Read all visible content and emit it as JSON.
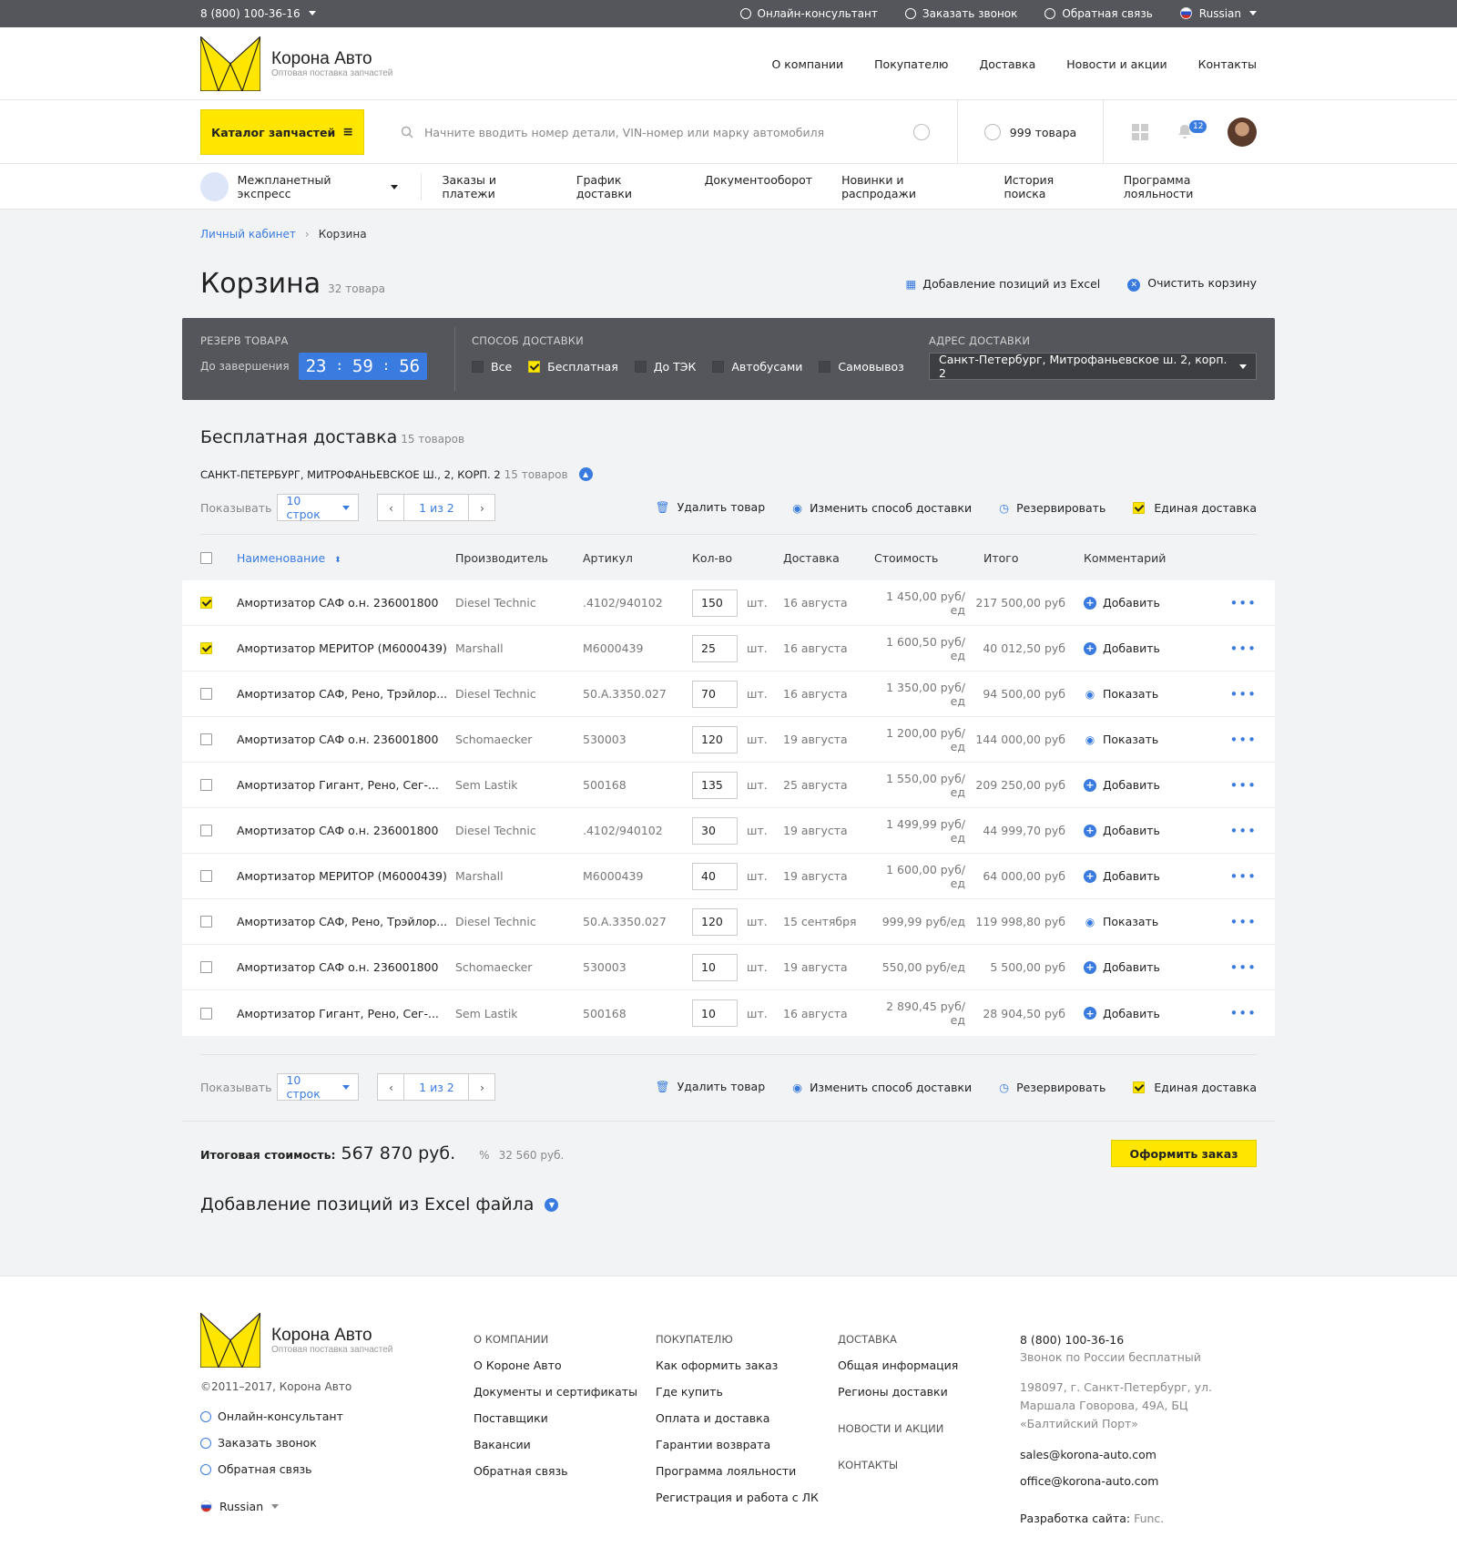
{
  "topbar": {
    "phone": "8 (800) 100-36-16",
    "links": [
      "Онлайн-консультант",
      "Заказать звонок",
      "Обратная связь"
    ],
    "language": "Russian"
  },
  "header": {
    "logo_name": "Корона Авто",
    "logo_sub": "Оптовая поставка запчастей",
    "nav": [
      "О компании",
      "Покупателю",
      "Доставка",
      "Новости и акции",
      "Контакты"
    ]
  },
  "search": {
    "catalog_label": "Каталог запчастей",
    "placeholder": "Начните вводить номер детали, VIN-номер или марку автомобиля",
    "cart_count": "999 товара",
    "notifications": "12"
  },
  "subnav": {
    "account": "Межпланетный экспресс",
    "links": [
      "Заказы и платежи",
      "График доставки",
      "Документооборот",
      "Новинки и распродажи",
      "История поиска",
      "Программа лояльности"
    ]
  },
  "breadcrumb": {
    "parent": "Личный кабинет",
    "current": "Корзина"
  },
  "page": {
    "title": "Корзина",
    "count": "32 товара",
    "excel_action": "Добавление позиций из Excel",
    "clear_action": "Очистить корзину"
  },
  "panel": {
    "reserve_label": "Резерв товара",
    "until_label": "До завершения",
    "timer": [
      "23",
      "59",
      "56"
    ],
    "delivery_label": "Способ доставки",
    "options": [
      {
        "label": "Все",
        "checked": false
      },
      {
        "label": "Бесплатная",
        "checked": true
      },
      {
        "label": "До ТЭК",
        "checked": false
      },
      {
        "label": "Автобусами",
        "checked": false
      },
      {
        "label": "Самовывоз",
        "checked": false
      }
    ],
    "address_label": "Адрес доставки",
    "address": "Санкт-Петербург, Митрофаньевское ш. 2, корп. 2"
  },
  "section": {
    "title": "Бесплатная доставка",
    "count": "15 товаров",
    "address": "САНКТ-ПЕТЕРБУРГ, МИТРОФАНЬЕВСКОЕ Ш., 2, КОРП. 2",
    "address_count": "15 товаров"
  },
  "tools": {
    "show_label": "Показывать",
    "rows": "10 строк",
    "page": "1 из 2",
    "delete": "Удалить товар",
    "change": "Изменить способ доставки",
    "reserve": "Резервировать",
    "single": "Единая доставка"
  },
  "table": {
    "headers": [
      "Наименование",
      "Производитель",
      "Артикул",
      "Кол-во",
      "Доставка",
      "Стоимость",
      "Итого",
      "Комментарий"
    ],
    "unit": "шт.",
    "rows": [
      {
        "checked": true,
        "name": "Амортизатор САФ о.н. 236001800",
        "maker": "Diesel Technic",
        "sku": ".4102/940102",
        "qty": "150",
        "date": "16 августа",
        "price": "1 450,00 руб/ед",
        "total": "217 500,00 руб",
        "comment": "Добавить",
        "ctype": "add"
      },
      {
        "checked": true,
        "name": "Амортизатор МЕРИТОР (M6000439)",
        "maker": "Marshall",
        "sku": "M6000439",
        "qty": "25",
        "date": "16 августа",
        "price": "1 600,50 руб/ед",
        "total": "40 012,50 руб",
        "comment": "Добавить",
        "ctype": "add"
      },
      {
        "checked": false,
        "name": "Амортизатор САФ, Рено, Трэйлор...",
        "maker": "Diesel Technic",
        "sku": "50.A.3350.027",
        "qty": "70",
        "date": "16 августа",
        "price": "1 350,00 руб/ед",
        "total": "94 500,00 руб",
        "comment": "Показать",
        "ctype": "show"
      },
      {
        "checked": false,
        "name": "Амортизатор САФ о.н. 236001800",
        "maker": "Schomaecker",
        "sku": "530003",
        "qty": "120",
        "date": "19 августа",
        "price": "1 200,00 руб/ед",
        "total": "144 000,00 руб",
        "comment": "Показать",
        "ctype": "show"
      },
      {
        "checked": false,
        "name": "Амортизатор Гигант, Рено, Сег-...",
        "maker": "Sem Lastik",
        "sku": "500168",
        "qty": "135",
        "date": "25 августа",
        "price": "1 550,00 руб/ед",
        "total": "209 250,00 руб",
        "comment": "Добавить",
        "ctype": "add"
      },
      {
        "checked": false,
        "name": "Амортизатор САФ о.н. 236001800",
        "maker": "Diesel Technic",
        "sku": ".4102/940102",
        "qty": "30",
        "date": "19 августа",
        "price": "1 499,99 руб/ед",
        "total": "44 999,70 руб",
        "comment": "Добавить",
        "ctype": "add"
      },
      {
        "checked": false,
        "name": "Амортизатор МЕРИТОР (M6000439)",
        "maker": "Marshall",
        "sku": "M6000439",
        "qty": "40",
        "date": "19 августа",
        "price": "1 600,00 руб/ед",
        "total": "64 000,00 руб",
        "comment": "Добавить",
        "ctype": "add"
      },
      {
        "checked": false,
        "name": "Амортизатор САФ, Рено, Трэйлор...",
        "maker": "Diesel Technic",
        "sku": "50.A.3350.027",
        "qty": "120",
        "date": "15 сентября",
        "price": "999,99 руб/ед",
        "total": "119 998,80 руб",
        "comment": "Показать",
        "ctype": "show"
      },
      {
        "checked": false,
        "name": "Амортизатор САФ о.н. 236001800",
        "maker": "Schomaecker",
        "sku": "530003",
        "qty": "10",
        "date": "19 августа",
        "price": "550,00 руб/ед",
        "total": "5 500,00 руб",
        "comment": "Добавить",
        "ctype": "add"
      },
      {
        "checked": false,
        "name": "Амортизатор Гигант, Рено, Сег-...",
        "maker": "Sem Lastik",
        "sku": "500168",
        "qty": "10",
        "date": "16 августа",
        "price": "2 890,45 руб/ед",
        "total": "28 904,50 руб",
        "comment": "Добавить",
        "ctype": "add"
      }
    ]
  },
  "total": {
    "label": "Итоговая стоимость:",
    "value": "567 870 руб.",
    "discount": "32 560 руб.",
    "order_button": "Оформить заказ"
  },
  "excel_section": "Добавление позиций из Excel файла",
  "footer": {
    "copyright": "©2011–2017, Корона Авто",
    "links": [
      "Онлайн-консультант",
      "Заказать звонок",
      "Обратная связь"
    ],
    "language": "Russian",
    "col_company": {
      "title": "О КОМПАНИИ",
      "items": [
        "О Короне Авто",
        "Документы и сертификаты",
        "Поставщики",
        "Вакансии",
        "Обратная связь"
      ]
    },
    "col_buyer": {
      "title": "ПОКУПАТЕЛЮ",
      "items": [
        "Как оформить заказ",
        "Где купить",
        "Оплата и доставка",
        "Гарантии возврата",
        "Программа лояльности",
        "Регистрация и работа с ЛК"
      ]
    },
    "col_delivery": {
      "title": "ДОСТАВКА",
      "items": [
        "Общая информация",
        "Регионы доставки"
      ],
      "news": "НОВОСТИ И АКЦИИ",
      "contacts": "КОНТАКТЫ"
    },
    "contact": {
      "phone": "8 (800) 100-36-16",
      "phone_note": "Звонок по России бесплатный",
      "address": "198097, г. Санкт-Петербург, ул. Маршала Говорова, 49А, БЦ «Балтийский Порт»",
      "email1": "sales@korona-auto.com",
      "email2": "office@korona-auto.com",
      "dev_label": "Разработка сайта:",
      "dev": "Func."
    }
  },
  "colors": {
    "accent": "#3a7be0",
    "yellow": "#ffe600",
    "dark": "#54565b"
  }
}
